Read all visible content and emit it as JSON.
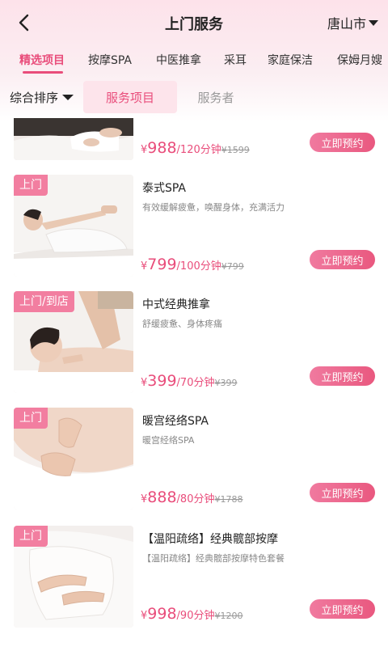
{
  "header": {
    "title": "上门服务",
    "city": "唐山市"
  },
  "category_tabs": [
    "精选项目",
    "按摩SPA",
    "中医推拿",
    "采耳",
    "家庭保洁",
    "保姆月嫂"
  ],
  "active_category_index": 0,
  "filter": {
    "sort_label": "综合排序",
    "segments": [
      "服务项目",
      "服务者"
    ],
    "active_segment_index": 0
  },
  "services": [
    {
      "name": "",
      "description": "",
      "badge": "",
      "price": "988",
      "duration": "/120分钟",
      "original_price": "¥1599",
      "book_label": "立即预约"
    },
    {
      "name": "泰式SPA",
      "description": "有效缓解疲惫，唤醒身体，充满活力",
      "badge": "上门",
      "price": "799",
      "duration": "/100分钟",
      "original_price": "¥799",
      "book_label": "立即预约"
    },
    {
      "name": "中式经典推拿",
      "description": "舒缓疲惫、身体疼痛",
      "badge": "上门/到店",
      "price": "399",
      "duration": "/70分钟",
      "original_price": "¥399",
      "book_label": "立即预约"
    },
    {
      "name": "暖宫经络SPA",
      "description": "暖宫经络SPA",
      "badge": "上门",
      "price": "888",
      "duration": "/80分钟",
      "original_price": "¥1788",
      "book_label": "立即预约"
    },
    {
      "name": "【温阳疏络】经典髋部按摩",
      "description": "【温阳疏络】经典髋部按摩特色套餐",
      "badge": "上门",
      "price": "998",
      "duration": "/90分钟",
      "original_price": "¥1200",
      "book_label": "立即预约"
    }
  ],
  "currency_symbol": "¥",
  "colors": {
    "accent": "#e94d7b",
    "badge": "#f27ea0",
    "segment_bg": "#fde4eb"
  }
}
